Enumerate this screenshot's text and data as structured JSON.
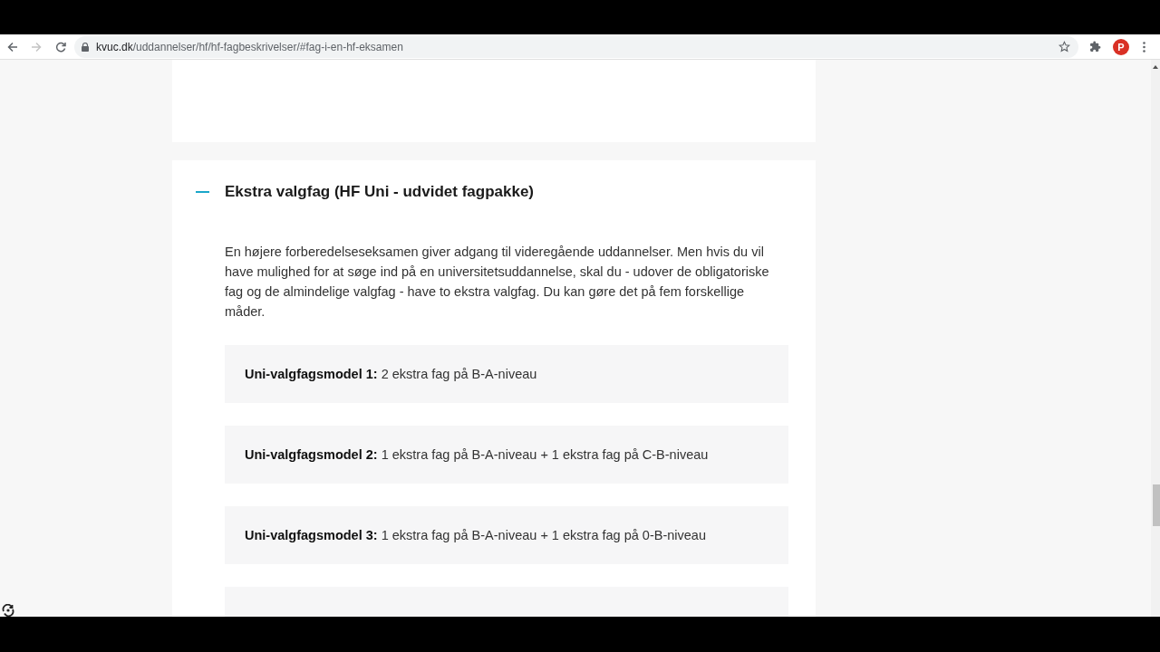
{
  "browser": {
    "back_disabled": false,
    "forward_disabled": true,
    "url": {
      "host": "kvuc.dk",
      "path": "/uddannelser/hf/hf-fagbeskrivelser/#fag-i-en-hf-eksamen"
    },
    "profile_initial": "P"
  },
  "accordion": {
    "title": "Ekstra valgfag (HF Uni - udvidet fagpakke)",
    "expanded": true,
    "intro": "En højere forberedelseseksamen giver adgang til videregående uddannelser. Men hvis du vil have mulighed for at søge ind på en universitetsuddannelse, skal du - udover de obligatoriske fag og de almindelige valgfag - have to ekstra valgfag. Du kan gøre det på fem forskellige måder.",
    "models": [
      {
        "text": "**Uni-valgfagsmodel 1:** 2 ekstra fag på B-A-niveau"
      },
      {
        "text": "**Uni-valgfagsmodel 2:** 1 ekstra fag på B-A-niveau + 1 ekstra fag på C-B-niveau"
      },
      {
        "text": "**Uni-valgfagsmodel 3:** 1 ekstra fag på B-A-niveau + 1 ekstra fag på 0-B-niveau"
      }
    ]
  }
}
